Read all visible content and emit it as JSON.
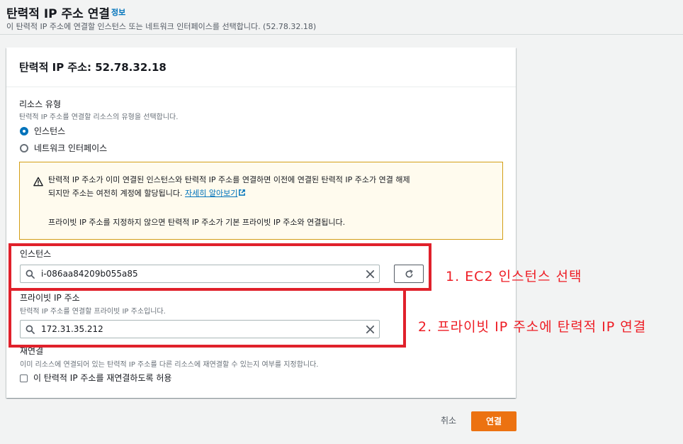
{
  "header": {
    "title": "탄력적 IP 주소 연결",
    "info_link": "정보",
    "subtitle": "이 탄력적 IP 주소에 연결할 인스턴스 또는 네트워크 인터페이스를 선택합니다. (52.78.32.18)"
  },
  "panel": {
    "title": "탄력적 IP 주소: 52.78.32.18"
  },
  "resource_type": {
    "label": "리소스 유형",
    "description": "탄력적 IP 주소를 연결할 리소스의 유형을 선택합니다.",
    "options": [
      {
        "label": "인스턴스",
        "selected": true
      },
      {
        "label": "네트워크 인터페이스",
        "selected": false
      }
    ]
  },
  "alert": {
    "line1": "탄력적 IP 주소가 이미 연결된 인스턴스와 탄력적 IP 주소를 연결하면 이전에 연결된 탄력적 IP 주소가 연결 해제",
    "line2": "되지만 주소는 여전히 계정에 할당됩니다.",
    "link": "자세히 알아보기",
    "line3": "프라이빗 IP 주소를 지정하지 않으면 탄력적 IP 주소가 기본 프라이빗 IP 주소와 연결됩니다."
  },
  "instance": {
    "label": "인스턴스",
    "value": "i-086aa84209b055a85"
  },
  "private_ip": {
    "label": "프라이빗 IP 주소",
    "description": "탄력적 IP 주소를 연결할 프라이빗 IP 주소입니다.",
    "value": "172.31.35.212"
  },
  "reassociation": {
    "label": "재연결",
    "description": "이미 리소스에 연결되어 있는 탄력적 IP 주소를 다른 리소스에 재연결할 수 있는지 여부를 지정합니다.",
    "checkbox_label": "이 탄력적 IP 주소를 재연결하도록 허용",
    "checked": false
  },
  "footer": {
    "cancel": "취소",
    "submit": "연결"
  },
  "annotations": {
    "step1": "1. EC2 인스턴스 선택",
    "step2": "2. 프라이빗 IP 주소에 탄력적 IP 연결"
  },
  "colors": {
    "primary": "#ec7211",
    "link": "#0073bb",
    "annotation": "#e0212b",
    "warning_border": "#d39e16"
  }
}
